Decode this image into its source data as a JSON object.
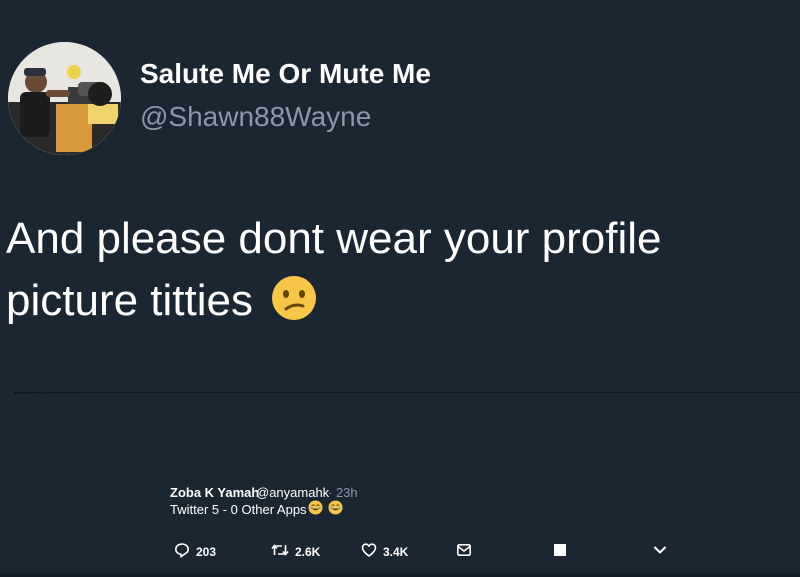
{
  "tweet": {
    "author_name": "Salute Me Or Mute Me",
    "author_handle": "@Shawn88Wayne",
    "text_line1": "And please dont wear your profile",
    "text_line2": "picture titties",
    "text_emoji": "confused-face-emoji"
  },
  "reply": {
    "author_name": "Zoba K Yamah",
    "author_handle": "@anyamahk",
    "time": "· 23h",
    "text": "Twitter 5 - 0 Other Apps",
    "emojis": [
      "face-with-tears-of-joy-emoji",
      "face-with-tears-of-joy-emoji"
    ]
  },
  "actions": {
    "replies": "203",
    "retweets": "2.6K",
    "likes": "3.4K"
  },
  "icons": [
    "reply-icon",
    "retweet-icon",
    "heart-icon",
    "message-icon",
    "square-icon",
    "chevron-down-icon"
  ],
  "colors": {
    "background": "#1b2633",
    "text_primary": "#ffffff",
    "text_secondary": "#8899a6",
    "emoji_yellow": "#f8c646"
  }
}
